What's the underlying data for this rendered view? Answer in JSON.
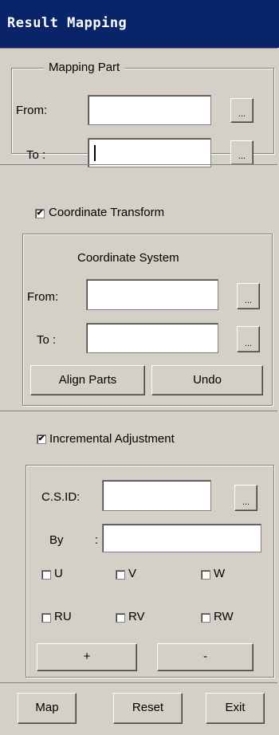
{
  "title": "Result Mapping",
  "mapping_part": {
    "legend": "Mapping Part",
    "from_label": "From:",
    "to_label": "To  :",
    "from_value": "",
    "to_value": "",
    "browse": "..."
  },
  "coordinate_transform": {
    "checkbox_label": "Coordinate Transform",
    "checked": true,
    "check_mark": "✔",
    "system_heading": "Coordinate System",
    "from_label": "From:",
    "to_label": "To  :",
    "from_value": "",
    "to_value": "",
    "browse": "...",
    "align_label": "Align Parts",
    "undo_label": "Undo"
  },
  "incremental": {
    "checkbox_label": "Incremental Adjustment",
    "checked": true,
    "check_mark": "✔",
    "csid_label": "C.S.ID:",
    "by_label": "By",
    "by_colon": ":",
    "csid_value": "",
    "by_value": "",
    "browse": "...",
    "dofs": [
      "U",
      "V",
      "W",
      "RU",
      "RV",
      "RW"
    ],
    "plus_label": "+",
    "minus_label": "-"
  },
  "footer": {
    "map_label": "Map",
    "reset_label": "Reset",
    "exit_label": "Exit"
  }
}
